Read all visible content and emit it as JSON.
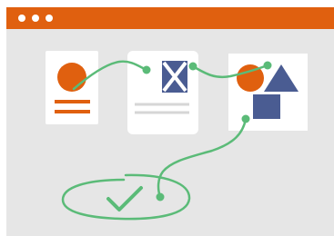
{
  "window": {
    "title_bar_color": "#e0600f",
    "background_color": "#e6e6e6",
    "controls": [
      "window-dot-icon",
      "window-dot-icon",
      "window-dot-icon"
    ]
  },
  "workflow": {
    "steps": [
      {
        "name": "document-card",
        "icon": "circle-document-icon"
      },
      {
        "name": "image-card",
        "icon": "image-placeholder-icon"
      },
      {
        "name": "shapes-card",
        "icon": "shapes-icon"
      }
    ],
    "completion_icon": "checkmark-icon",
    "accent_color": "#e0600f",
    "connector_color": "#5bbb78",
    "shape_color": "#4a5c92"
  }
}
